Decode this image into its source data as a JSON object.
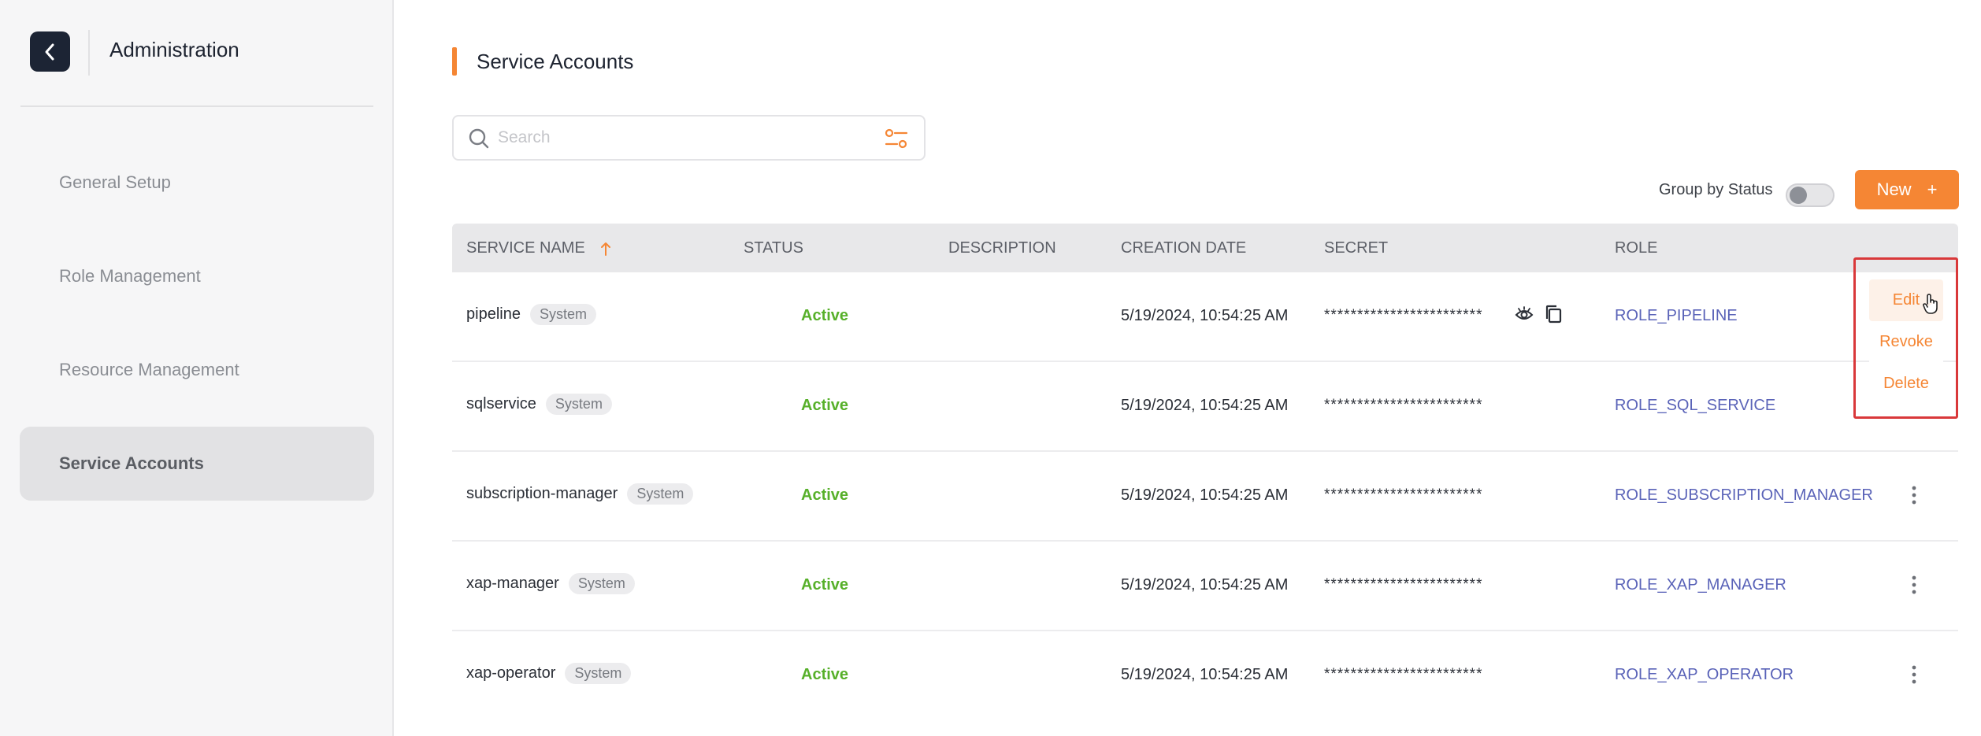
{
  "sidebar": {
    "title": "Administration",
    "items": [
      {
        "label": "General Setup"
      },
      {
        "label": "Role Management"
      },
      {
        "label": "Resource Management"
      },
      {
        "label": "Service Accounts"
      }
    ]
  },
  "page": {
    "title": "Service Accounts",
    "accent": "#f58634"
  },
  "search": {
    "placeholder": "Search"
  },
  "toolbar": {
    "group_label": "Group by Status",
    "group_enabled": false,
    "new_label": "New",
    "new_icon": "+"
  },
  "table": {
    "columns": [
      "SERVICE NAME",
      "STATUS",
      "DESCRIPTION",
      "CREATION DATE",
      "SECRET",
      "ROLE"
    ],
    "sort_column": "SERVICE NAME",
    "sort_direction": "ascending",
    "rows": [
      {
        "name": "pipeline",
        "tag": "System",
        "status": "Active",
        "description": "",
        "date": "5/19/2024, 10:54:25 AM",
        "secret": "************************",
        "role": "ROLE_PIPELINE"
      },
      {
        "name": "sqlservice",
        "tag": "System",
        "status": "Active",
        "description": "",
        "date": "5/19/2024, 10:54:25 AM",
        "secret": "************************",
        "role": "ROLE_SQL_SERVICE"
      },
      {
        "name": "subscription-manager",
        "tag": "System",
        "status": "Active",
        "description": "",
        "date": "5/19/2024, 10:54:25 AM",
        "secret": "************************",
        "role": "ROLE_SUBSCRIPTION_MANAGER"
      },
      {
        "name": "xap-manager",
        "tag": "System",
        "status": "Active",
        "description": "",
        "date": "5/19/2024, 10:54:25 AM",
        "secret": "************************",
        "role": "ROLE_XAP_MANAGER"
      },
      {
        "name": "xap-operator",
        "tag": "System",
        "status": "Active",
        "description": "",
        "date": "5/19/2024, 10:54:25 AM",
        "secret": "************************",
        "role": "ROLE_XAP_OPERATOR"
      }
    ]
  },
  "row_menu": {
    "items": [
      "Edit",
      "Revoke",
      "Delete"
    ],
    "hovered": "Edit"
  },
  "colors": {
    "status_active": "#57b02a",
    "role_link": "#5a63b8",
    "highlight_box": "#d9383a"
  },
  "icons": {
    "back": "chevron-left-icon",
    "search": "search-icon",
    "filter": "filter-settings-icon",
    "sort": "arrow-up-icon",
    "reveal": "eye-icon",
    "copy": "copy-icon",
    "more": "kebab-icon",
    "pointer": "hand-pointer-icon"
  }
}
